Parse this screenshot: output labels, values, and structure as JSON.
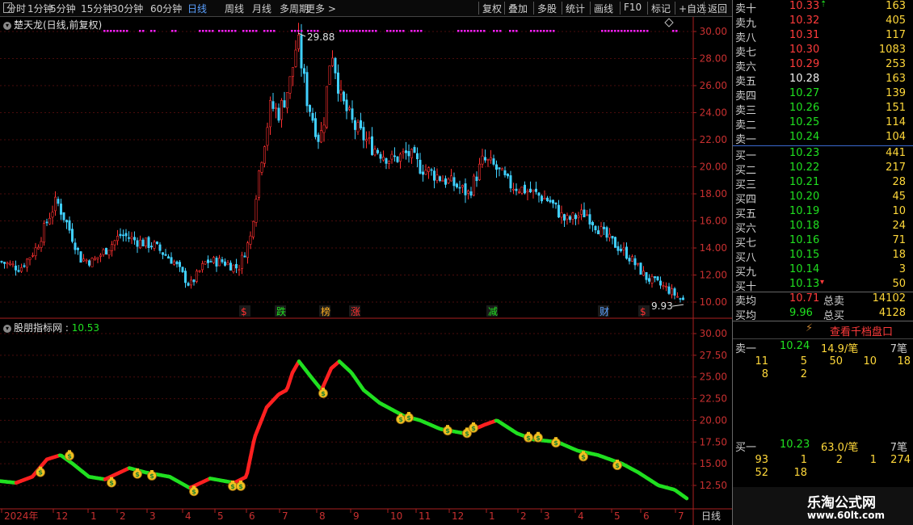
{
  "toolbar": {
    "periods": [
      "分时",
      "1分钟",
      "5分钟",
      "15分钟",
      "30分钟",
      "60分钟",
      "日线",
      "周线",
      "月线",
      "多周期",
      "更多 >"
    ],
    "active_period": "日线",
    "actions": [
      "复权",
      "叠加",
      "多股",
      "统计",
      "画线",
      "F10",
      "标记",
      "+自选",
      "返回"
    ]
  },
  "main_chart": {
    "title": "楚天龙(日线,前复权)",
    "high_label": "29.88",
    "low_label": "9.93",
    "y_ticks": [
      "30.00",
      "28.00",
      "26.00",
      "24.00",
      "22.00",
      "20.00",
      "18.00",
      "16.00",
      "14.00",
      "12.00",
      "10.00"
    ],
    "event_labels": [
      {
        "text": "$",
        "color": "#ff3030"
      },
      {
        "text": "跌",
        "color": "#20e020"
      },
      {
        "text": "榜",
        "color": "#ffb020"
      },
      {
        "text": "涨",
        "color": "#ff3030"
      },
      {
        "text": "减",
        "color": "#20e020"
      },
      {
        "text": "财",
        "color": "#5aa0ff"
      },
      {
        "text": "$",
        "color": "#ff3030"
      }
    ]
  },
  "indicator": {
    "title": "股朋指标网",
    "value": "10.53",
    "y_ticks": [
      "30.00",
      "27.50",
      "25.00",
      "22.50",
      "20.00",
      "17.50",
      "15.00",
      "12.50"
    ]
  },
  "time_axis": {
    "labels": [
      "2024年",
      "12",
      "1",
      "2",
      "3",
      "4",
      "5",
      "6",
      "7",
      "8",
      "9",
      "10",
      "11",
      "12",
      "1",
      "2",
      "3",
      "4",
      "5",
      "6",
      "7"
    ],
    "period_label": "日线"
  },
  "order_book": {
    "asks": [
      {
        "label": "卖十",
        "price": "10.33",
        "vol": "163",
        "color": "up"
      },
      {
        "label": "卖九",
        "price": "10.32",
        "vol": "405",
        "color": "up"
      },
      {
        "label": "卖八",
        "price": "10.31",
        "vol": "117",
        "color": "up"
      },
      {
        "label": "卖七",
        "price": "10.30",
        "vol": "1083",
        "color": "up"
      },
      {
        "label": "卖六",
        "price": "10.29",
        "vol": "253",
        "color": "up"
      },
      {
        "label": "卖五",
        "price": "10.28",
        "vol": "163",
        "color": "wh"
      },
      {
        "label": "卖四",
        "price": "10.27",
        "vol": "139",
        "color": "dn"
      },
      {
        "label": "卖三",
        "price": "10.26",
        "vol": "151",
        "color": "dn"
      },
      {
        "label": "卖二",
        "price": "10.25",
        "vol": "114",
        "color": "dn"
      },
      {
        "label": "卖一",
        "price": "10.24",
        "vol": "104",
        "color": "dn"
      }
    ],
    "bids": [
      {
        "label": "买一",
        "price": "10.23",
        "vol": "441",
        "color": "dn"
      },
      {
        "label": "买二",
        "price": "10.22",
        "vol": "217",
        "color": "dn"
      },
      {
        "label": "买三",
        "price": "10.21",
        "vol": "28",
        "color": "dn"
      },
      {
        "label": "买四",
        "price": "10.20",
        "vol": "45",
        "color": "dn"
      },
      {
        "label": "买五",
        "price": "10.19",
        "vol": "10",
        "color": "dn"
      },
      {
        "label": "买六",
        "price": "10.18",
        "vol": "24",
        "color": "dn"
      },
      {
        "label": "买七",
        "price": "10.16",
        "vol": "71",
        "color": "dn"
      },
      {
        "label": "买八",
        "price": "10.15",
        "vol": "18",
        "color": "dn"
      },
      {
        "label": "买九",
        "price": "10.14",
        "vol": "3",
        "color": "dn"
      },
      {
        "label": "买十",
        "price": "10.13",
        "vol": "50",
        "color": "dn"
      }
    ],
    "ask_avg_label": "卖均",
    "ask_avg": "10.71",
    "total_sell_label": "总卖",
    "total_sell": "14102",
    "bid_avg_label": "买均",
    "bid_avg": "9.96",
    "total_buy_label": "总买",
    "total_buy": "4128"
  },
  "tape": {
    "button_label": "查看千档盘口",
    "ask1_label": "卖一",
    "ask1_price": "10.24",
    "ask1_avg": "14.9/笔",
    "ask1_count": "7笔",
    "ask1_queue": [
      "11",
      "5",
      "50",
      "10",
      "18",
      "8",
      "2"
    ],
    "bid1_label": "买一",
    "bid1_price": "10.23",
    "bid1_avg": "63.0/笔",
    "bid1_count": "7笔",
    "bid1_queue": [
      "93",
      "1",
      "2",
      "1",
      "274",
      "52",
      "18"
    ]
  },
  "watermark": {
    "name": "乐淘公式网",
    "url": "www.60lt.com"
  },
  "colors": {
    "up": "#ff3b3b",
    "down": "#20e020",
    "grid": "#5a1010",
    "axis": "#aa2020"
  }
}
